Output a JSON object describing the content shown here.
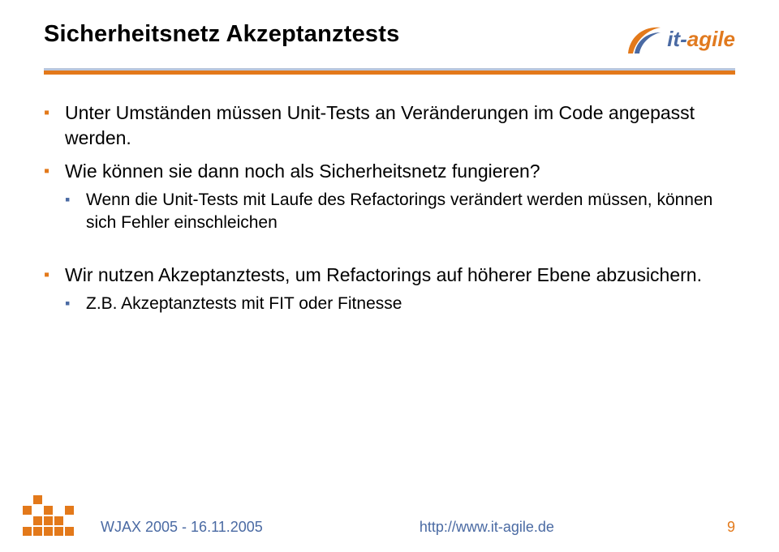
{
  "header": {
    "title": "Sicherheitsnetz Akzeptanztests",
    "logo": {
      "part1": "it",
      "dash": "-",
      "part2": "agile"
    }
  },
  "bullets": [
    {
      "text": "Unter Umständen müssen Unit-Tests an Veränderungen im Code angepasst werden."
    },
    {
      "text": "Wie können sie dann noch als Sicherheitsnetz fungieren?",
      "sub": [
        {
          "text": "Wenn die Unit-Tests mit Laufe des Refactorings verändert werden müssen, können sich Fehler einschleichen"
        }
      ]
    }
  ],
  "bullets2": [
    {
      "text": "Wir nutzen Akzeptanztests, um Refactorings auf höherer Ebene abzusichern.",
      "sub": [
        {
          "text": "Z.B. Akzeptanztests mit FIT oder Fitnesse"
        }
      ]
    }
  ],
  "footer": {
    "left": "WJAX 2005 - 16.11.2005",
    "center": "http://www.it-agile.de",
    "page": "9"
  }
}
